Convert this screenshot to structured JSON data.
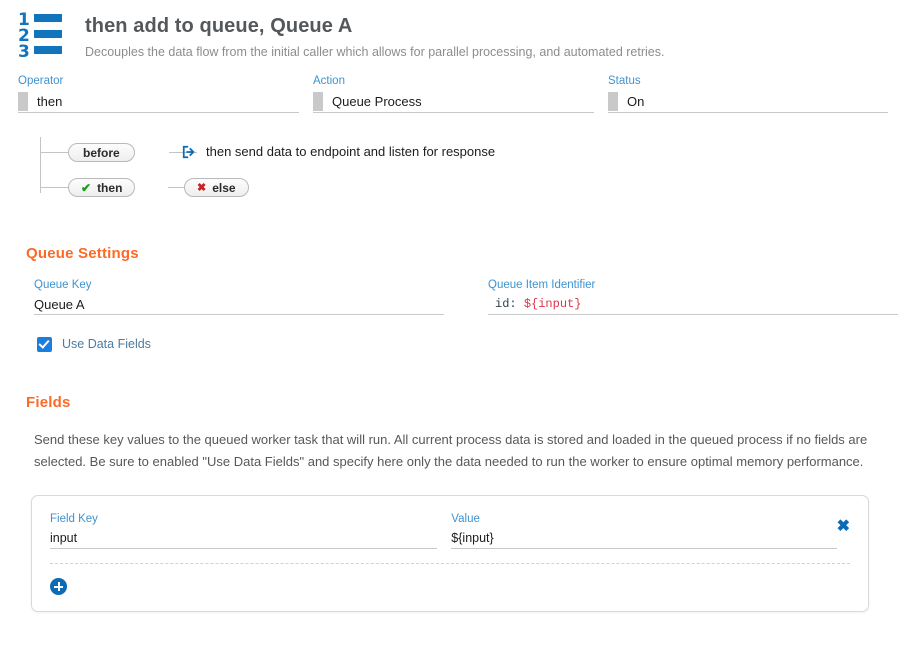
{
  "header": {
    "icon": "numbered-list-icon",
    "title": "then add to queue, Queue A",
    "subtitle": "Decouples the data flow from the initial caller which allows for parallel processing, and automated retries."
  },
  "top_fields": [
    {
      "label": "Operator",
      "value": "then"
    },
    {
      "label": "Action",
      "value": "Queue Process"
    },
    {
      "label": "Status",
      "value": "On"
    }
  ],
  "flow": {
    "before_pill": "before",
    "then_pill": "then",
    "else_pill": "else",
    "action_icon": "arrow-right-from-bracket-icon",
    "action_text": "then send data to endpoint and listen for response",
    "check_glyph": "✔",
    "cross_glyph": "✖"
  },
  "queue_settings": {
    "heading": "Queue Settings",
    "queue_key": {
      "label": "Queue Key",
      "value": "Queue A"
    },
    "queue_item_identifier": {
      "label": "Queue Item Identifier",
      "key_text": "id:",
      "var_text": "${input}"
    },
    "use_data_fields": {
      "label": "Use Data Fields",
      "checked": true
    }
  },
  "fields_section": {
    "heading": "Fields",
    "description": "Send these key values to the queued worker task that will run. All current process data is stored and loaded in the queued process if no fields are selected. Be sure to enabled \"Use Data Fields\" and specify here only the data needed to run the worker to ensure optimal memory performance.",
    "columns": {
      "key_label": "Field Key",
      "value_label": "Value"
    },
    "rows": [
      {
        "key": "input",
        "value": "${input}"
      }
    ],
    "remove_glyph": "✖",
    "add_label": "add-field"
  },
  "colors": {
    "accent_orange": "#fc6a28",
    "label_blue": "#3f93d0",
    "icon_blue": "#1274bd",
    "action_blue": "#0b6bb4",
    "checkbox_blue": "#1a7ee0",
    "var_red": "#e0344b",
    "tick_green": "#13a113",
    "cross_red": "#cc1f1f"
  },
  "icon_numerals": [
    "1",
    "2",
    "3"
  ]
}
